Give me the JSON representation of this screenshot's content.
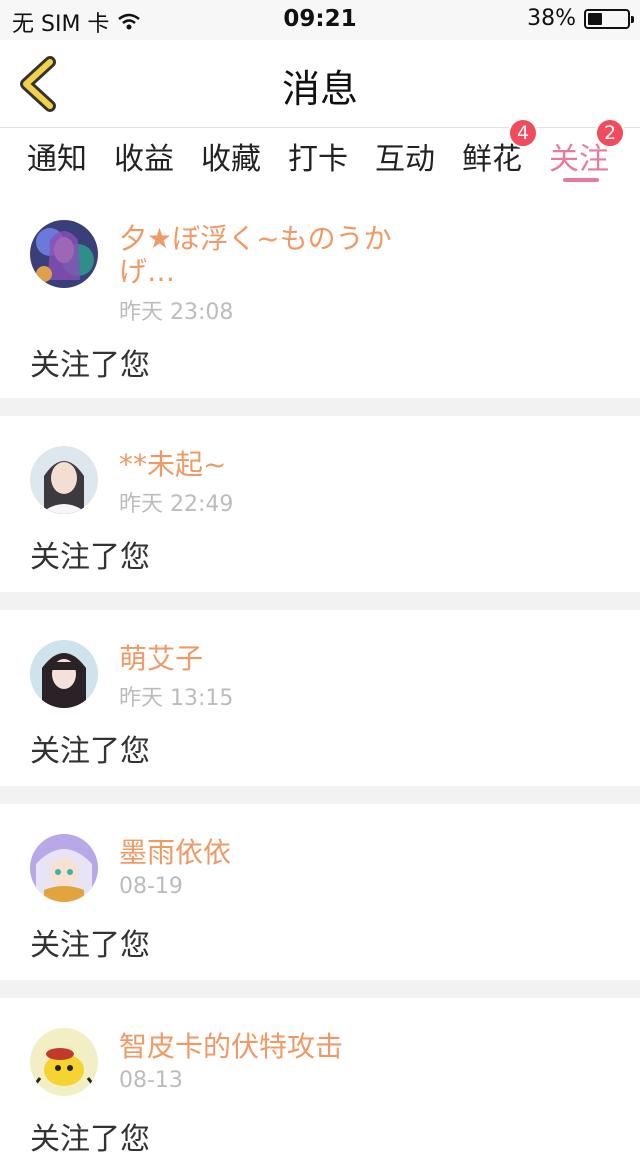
{
  "status_bar": {
    "carrier": "无 SIM 卡",
    "time": "09:21",
    "battery": "38%"
  },
  "nav": {
    "title": "消息"
  },
  "tabs": [
    {
      "label": "通知",
      "badge": ""
    },
    {
      "label": "收益",
      "badge": ""
    },
    {
      "label": "收藏",
      "badge": ""
    },
    {
      "label": "打卡",
      "badge": ""
    },
    {
      "label": "互动",
      "badge": ""
    },
    {
      "label": "鲜花",
      "badge": "4"
    },
    {
      "label": "关注",
      "badge": "2",
      "active": true
    }
  ],
  "messages": [
    {
      "name": "夕★ぼ浮く~ものうかげ…",
      "time": "昨天 23:08",
      "text": "关注了您"
    },
    {
      "name": "**未起~",
      "time": "昨天 22:49",
      "text": "关注了您"
    },
    {
      "name": "萌艾子",
      "time": "昨天 13:15",
      "text": "关注了您"
    },
    {
      "name": "墨雨依依",
      "time": "08-19",
      "text": "关注了您"
    },
    {
      "name": "智皮卡的伏特攻击",
      "time": "08-13",
      "text": "关注了您"
    }
  ],
  "colors": {
    "accent": "#e87aa2",
    "username": "#ef9a66",
    "badge": "#f24b5b",
    "back_arrow": "#f2d14a"
  }
}
